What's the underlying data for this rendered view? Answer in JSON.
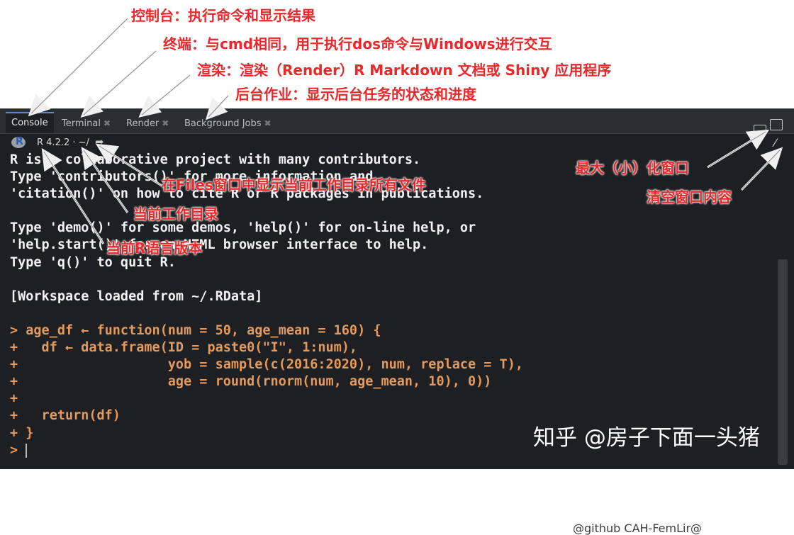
{
  "annotations": {
    "console": "控制台：执行命令和显示结果",
    "terminal": "终端：与cmd相同，用于执行dos命令与Windows进行交互",
    "render": "渲染：渲染（Render）R Markdown 文档或 Shiny 应用程序",
    "background_jobs": "后台作业：显示后台任务的状态和进度",
    "files": "在Files窗口中显示当前工作目录所有文件",
    "working_dir": "当前工作目录",
    "r_version": "当前R语言版本",
    "maximize": "最大（小）化窗口",
    "clear": "清空窗口内容"
  },
  "tabs": [
    {
      "label": "Console",
      "closable": false
    },
    {
      "label": "Terminal",
      "closable": true
    },
    {
      "label": "Render",
      "closable": true
    },
    {
      "label": "Background Jobs",
      "closable": true
    }
  ],
  "toolbar": {
    "r_logo": "R",
    "r_version": "R 4.2.2 · ~/",
    "forward_icon": "arrow-forward-icon",
    "clear_icon": "broom-icon"
  },
  "console_lines": [
    {
      "text": "R is a collaborative project with many contributors.",
      "type": "out"
    },
    {
      "text": "Type 'contributors()' for more information and",
      "type": "out"
    },
    {
      "text": "'citation()' on how to cite R or R packages in publications.",
      "type": "out"
    },
    {
      "text": "",
      "type": "out"
    },
    {
      "text": "Type 'demo()' for some demos, 'help()' for on-line help, or",
      "type": "out"
    },
    {
      "text": "'help.start()' for an HTML browser interface to help.",
      "type": "out"
    },
    {
      "text": "Type 'q()' to quit R.",
      "type": "out"
    },
    {
      "text": "",
      "type": "out"
    },
    {
      "text": "[Workspace loaded from ~/.RData]",
      "type": "out"
    },
    {
      "text": "",
      "type": "out"
    },
    {
      "text": "> age_df ← function(num = 50, age_mean = 160) {",
      "type": "code"
    },
    {
      "text": "+   df ← data.frame(ID = paste0(\"I\", 1:num),",
      "type": "code"
    },
    {
      "text": "+                   yob = sample(c(2016:2020), num, replace = T),",
      "type": "code"
    },
    {
      "text": "+                   age = round(rnorm(num, age_mean, 10), 0))",
      "type": "code"
    },
    {
      "text": "+",
      "type": "code"
    },
    {
      "text": "+   return(df)",
      "type": "code"
    },
    {
      "text": "+ }",
      "type": "code"
    },
    {
      "text": "> ",
      "type": "code"
    }
  ],
  "watermark": "知乎 @房子下面一头猪",
  "watermark_faint": "@github CAH-FemLir@"
}
